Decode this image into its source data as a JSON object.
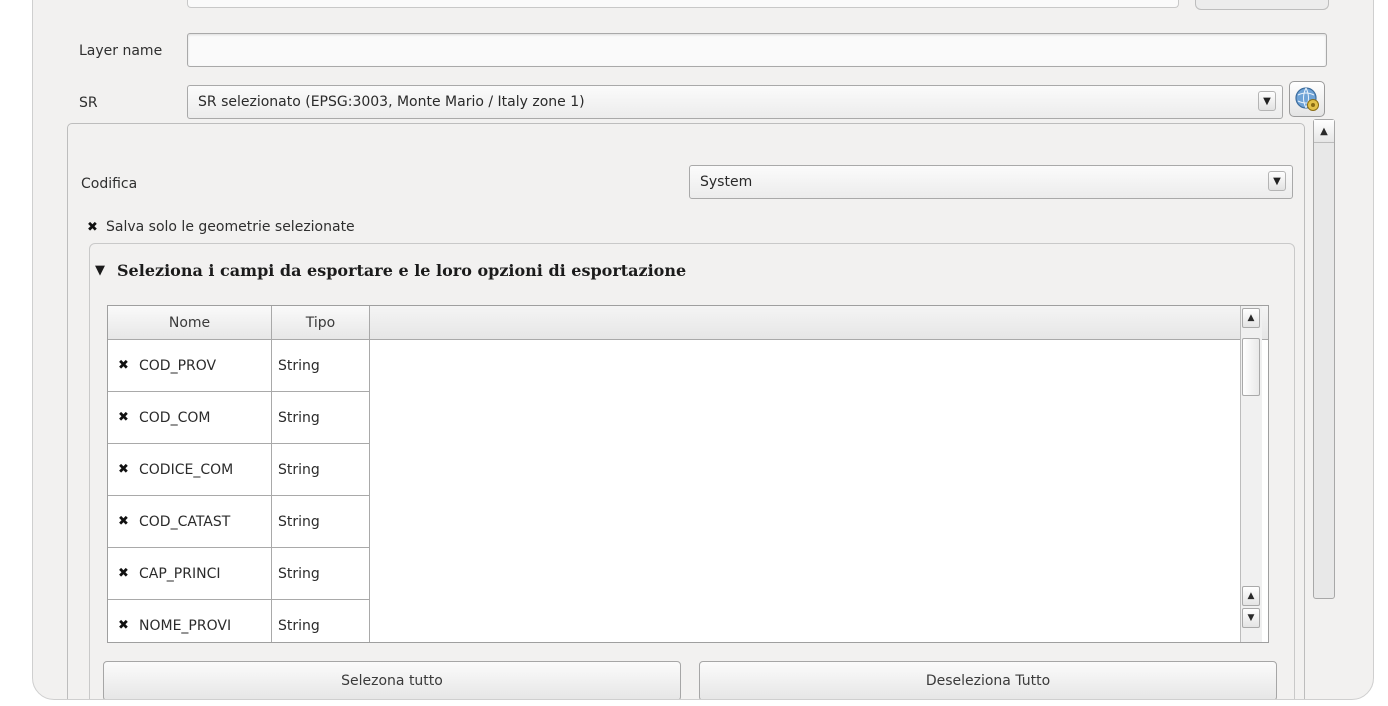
{
  "layer": {
    "label": "Layer name",
    "value": ""
  },
  "sr": {
    "label": "SR",
    "value": "SR selezionato (EPSG:3003, Monte Mario / Italy zone 1)",
    "icon": "globe-gear-icon"
  },
  "encoding": {
    "label": "Codifica",
    "value": "System"
  },
  "save_selected": {
    "label": "Salva solo le geometrie selezionate",
    "checked": true
  },
  "fields_group": {
    "title": "Seleziona i campi da esportare e le loro opzioni di esportazione",
    "columns": [
      "Nome",
      "Tipo"
    ],
    "rows": [
      {
        "name": "COD_PROV",
        "type": "String",
        "checked": true
      },
      {
        "name": "COD_COM",
        "type": "String",
        "checked": true
      },
      {
        "name": "CODICE_COM",
        "type": "String",
        "checked": true
      },
      {
        "name": "COD_CATAST",
        "type": "String",
        "checked": true
      },
      {
        "name": "CAP_PRINCI",
        "type": "String",
        "checked": true
      },
      {
        "name": "NOME_PROVI",
        "type": "String",
        "checked": true
      }
    ]
  },
  "buttons": {
    "select_all": "Selezona tutto",
    "deselect_all": "Deseleziona Tutto"
  },
  "glyphs": {
    "check": "✖",
    "arrow_down": "▼",
    "arrow_up": "▲",
    "collapse": "▼"
  }
}
